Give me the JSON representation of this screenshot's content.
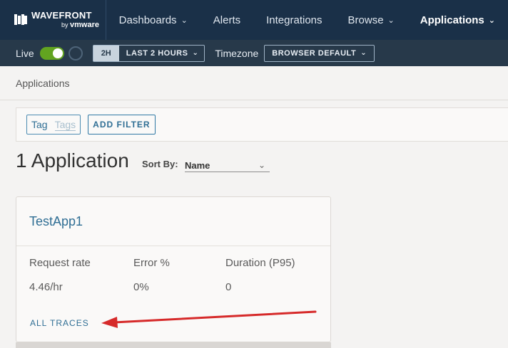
{
  "brand": {
    "name": "WAVEFRONT",
    "by": "by",
    "company": "vmware"
  },
  "nav": {
    "items": [
      {
        "label": "Dashboards",
        "dropdown": true
      },
      {
        "label": "Alerts",
        "dropdown": false
      },
      {
        "label": "Integrations",
        "dropdown": false
      },
      {
        "label": "Browse",
        "dropdown": true
      },
      {
        "label": "Applications",
        "dropdown": true,
        "active": true
      }
    ]
  },
  "subbar": {
    "live_label": "Live",
    "live_on": true,
    "range_short": "2H",
    "range_label": "LAST 2 HOURS",
    "timezone_label": "Timezone",
    "timezone_value": "BROWSER DEFAULT"
  },
  "breadcrumb": "Applications",
  "filter": {
    "tag_label": "Tag",
    "tag_placeholder": "Tags",
    "add_filter": "ADD FILTER"
  },
  "list": {
    "count_title": "1 Application",
    "sort_label": "Sort By:",
    "sort_value": "Name"
  },
  "card": {
    "title": "TestApp1",
    "metrics": [
      {
        "label": "Request rate",
        "value": "4.46/hr"
      },
      {
        "label": "Error %",
        "value": "0%"
      },
      {
        "label": "Duration (P95)",
        "value": "0"
      }
    ],
    "link": "ALL TRACES"
  },
  "colors": {
    "nav_bg": "#1a3048",
    "subbar_bg": "#27394a",
    "accent_link": "#2f6e94",
    "toggle_on": "#62a420",
    "annotation_arrow": "#d62a2a"
  },
  "icons": {
    "dropdown": "chevron-down-icon",
    "annotation": "arrow-icon"
  }
}
